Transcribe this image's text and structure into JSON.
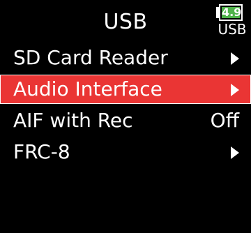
{
  "header": {
    "title": "USB",
    "battery": {
      "voltage": "4.9",
      "source": "USB",
      "fill_color": "#4fb24a"
    }
  },
  "menu": {
    "selected_color": "#ea3534",
    "items": [
      {
        "label": "SD Card Reader",
        "value": "",
        "has_submenu": true,
        "selected": false
      },
      {
        "label": "Audio Interface",
        "value": "",
        "has_submenu": true,
        "selected": true
      },
      {
        "label": "AIF with Rec",
        "value": "Off",
        "has_submenu": false,
        "selected": false
      },
      {
        "label": "FRC-8",
        "value": "",
        "has_submenu": true,
        "selected": false
      }
    ]
  }
}
